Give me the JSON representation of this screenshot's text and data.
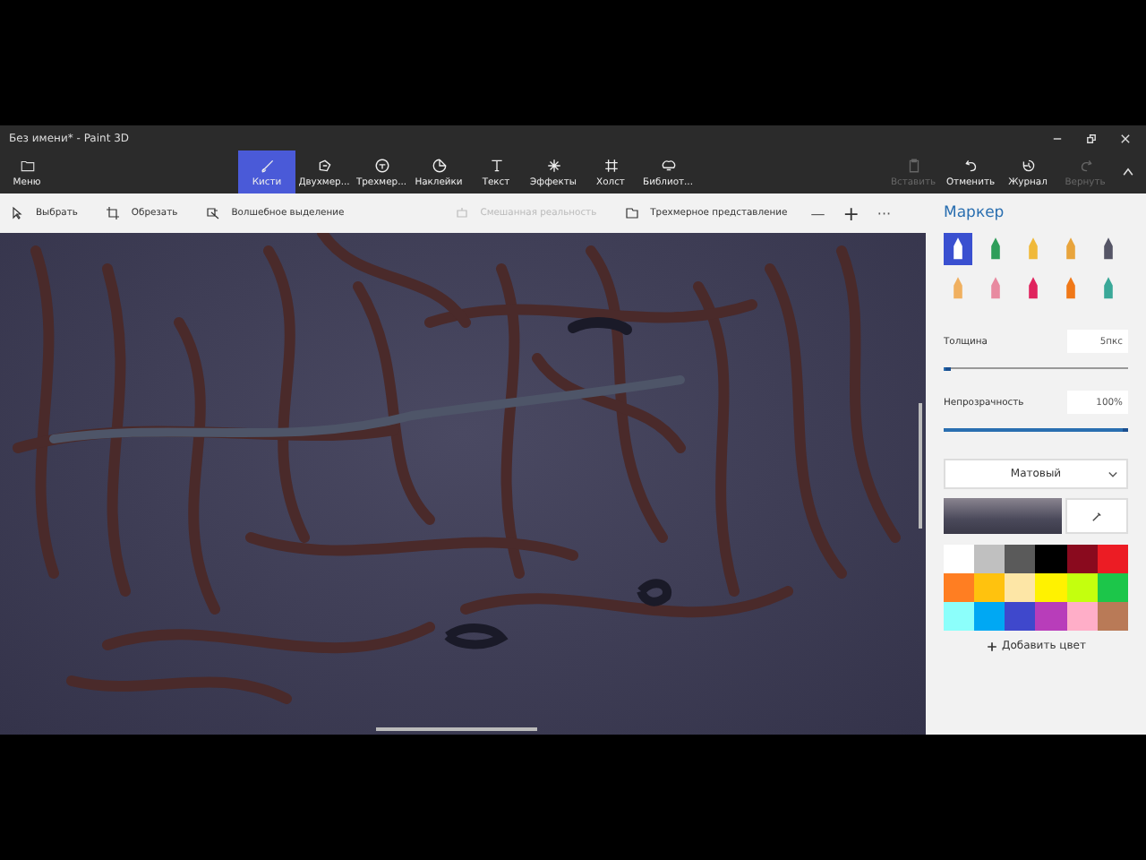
{
  "window": {
    "title": "Без имени* - Paint 3D"
  },
  "menu": {
    "label": "Меню"
  },
  "tools": [
    {
      "kind": "brush",
      "label": "Кисти",
      "selected": true
    },
    {
      "kind": "shape2d",
      "label": "Двухмер...",
      "selected": false
    },
    {
      "kind": "shape3d",
      "label": "Трехмер...",
      "selected": false
    },
    {
      "kind": "sticker",
      "label": "Наклейки",
      "selected": false
    },
    {
      "kind": "text",
      "label": "Текст",
      "selected": false
    },
    {
      "kind": "effects",
      "label": "Эффекты",
      "selected": false
    },
    {
      "kind": "canvas",
      "label": "Холст",
      "selected": false
    },
    {
      "kind": "library",
      "label": "Библиот...",
      "selected": false
    }
  ],
  "actions": [
    {
      "kind": "paste",
      "label": "Вставить",
      "disabled": true
    },
    {
      "kind": "undo",
      "label": "Отменить",
      "disabled": false
    },
    {
      "kind": "history",
      "label": "Журнал",
      "disabled": false
    },
    {
      "kind": "redo",
      "label": "Вернуть",
      "disabled": true
    }
  ],
  "toolbar": [
    {
      "kind": "select",
      "label": "Выбрать",
      "disabled": false
    },
    {
      "kind": "crop",
      "label": "Обрезать",
      "disabled": false
    },
    {
      "kind": "magic",
      "label": "Волшебное выделение",
      "disabled": false
    },
    {
      "kind": "mixed",
      "label": "Смешанная реальность",
      "disabled": true
    },
    {
      "kind": "view3d",
      "label": "Трехмерное представление",
      "disabled": false
    }
  ],
  "zoom": {
    "out": "—",
    "in": "+",
    "more": "···"
  },
  "panel": {
    "title": "Маркер",
    "brushes": [
      {
        "color": "#ffffff",
        "selected": true
      },
      {
        "color": "#2f9e5a",
        "selected": false
      },
      {
        "color": "#f0b93a",
        "selected": false
      },
      {
        "color": "#e8a43c",
        "selected": false
      },
      {
        "color": "#555566",
        "selected": false
      },
      {
        "color": "#f0b060",
        "selected": false
      },
      {
        "color": "#e88aa0",
        "selected": false
      },
      {
        "color": "#e0245e",
        "selected": false
      },
      {
        "color": "#f07818",
        "selected": false
      },
      {
        "color": "#3aa898",
        "selected": false
      }
    ],
    "thickness": {
      "label": "Толщина",
      "value": "5пкс",
      "level": 0.04
    },
    "opacity": {
      "label": "Непрозрачность",
      "value": "100%",
      "level": 1
    },
    "finish": "Матовый",
    "colors": [
      {
        "color": "#ffffff"
      },
      {
        "color": "#c0c0c0"
      },
      {
        "color": "#5a5a5a"
      },
      {
        "color": "#000000"
      },
      {
        "color": "#8a0a1e"
      },
      {
        "color": "#ec1c24"
      },
      {
        "color": "#ff7e22"
      },
      {
        "color": "#ffc20e"
      },
      {
        "color": "#fde6a6"
      },
      {
        "color": "#fff200"
      },
      {
        "color": "#c4ff0e"
      },
      {
        "color": "#1cc64a"
      },
      {
        "color": "#8cfffb"
      },
      {
        "color": "#00a8f3"
      },
      {
        "color": "#3f48cc"
      },
      {
        "color": "#b83dba"
      },
      {
        "color": "#ffaec8"
      },
      {
        "color": "#b97a57"
      }
    ],
    "add_color": "Добавить цвет"
  }
}
